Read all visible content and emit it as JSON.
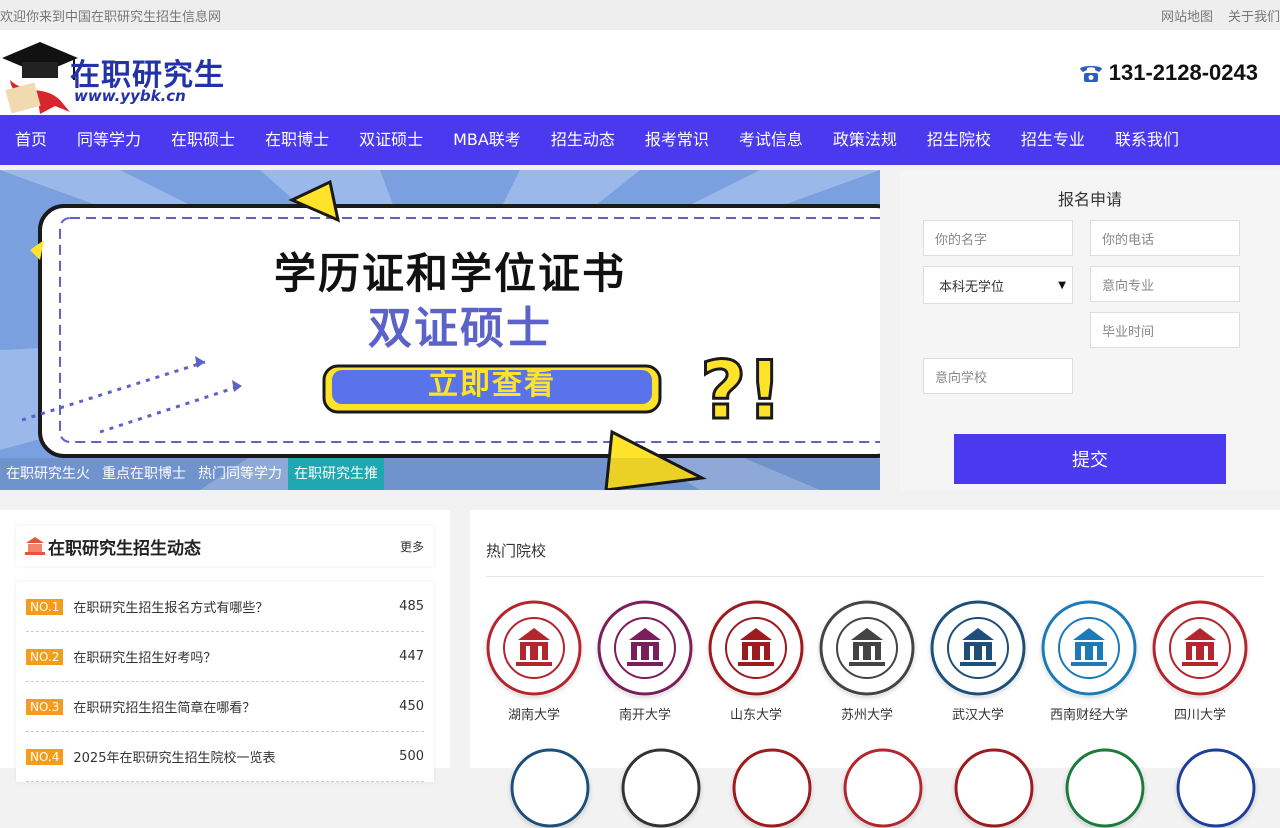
{
  "topbar": {
    "welcome": "欢迎你来到中国在职研究生招生信息网",
    "links": [
      "网站地图",
      "关于我们"
    ]
  },
  "header": {
    "logo_text": "在职研究生",
    "logo_url": "www.yybk.cn",
    "phone": "131-2128-0243"
  },
  "nav": [
    "首页",
    "同等学力",
    "在职硕士",
    "在职博士",
    "双证硕士",
    "MBA联考",
    "招生动态",
    "报考常识",
    "考试信息",
    "政策法规",
    "招生院校",
    "招生专业",
    "联系我们"
  ],
  "banner": {
    "headline": "学历证和学位证书",
    "subhead": "双证硕士",
    "cta": "立即查看",
    "captions": [
      "在职研究生火",
      "重点在职博士",
      "热门同等学力",
      "在职研究生推"
    ]
  },
  "form": {
    "title": "报名申请",
    "name_placeholder": "你的名字",
    "phone_placeholder": "你的电话",
    "degree_value": "本科无学位",
    "major_placeholder": "意向专业",
    "grad_placeholder": "毕业时间",
    "school_placeholder": "意向学校",
    "submit": "提交"
  },
  "news": {
    "title": "在职研究生招生动态",
    "more": "更多",
    "items": [
      {
        "rank": "NO.1",
        "title": "在职研究生招生报名方式有哪些？",
        "count": "485"
      },
      {
        "rank": "NO.2",
        "title": "在职研究生招生好考吗？",
        "count": "447"
      },
      {
        "rank": "NO.3",
        "title": "在职研究招生招生简章在哪看？",
        "count": "450"
      },
      {
        "rank": "NO.4",
        "title": "2025年在职研究生招生院校一览表",
        "count": "500"
      }
    ]
  },
  "schools": {
    "title": "热门院校",
    "items": [
      {
        "name": "湖南大学",
        "color": "#b3262d"
      },
      {
        "name": "南开大学",
        "color": "#7a1f5c"
      },
      {
        "name": "山东大学",
        "color": "#9b1b1f"
      },
      {
        "name": "苏州大学",
        "color": "#444444"
      },
      {
        "name": "武汉大学",
        "color": "#1d4f7a"
      },
      {
        "name": "西南财经大学",
        "color": "#1b7bb8"
      },
      {
        "name": "四川大学",
        "color": "#b3262d"
      }
    ]
  }
}
